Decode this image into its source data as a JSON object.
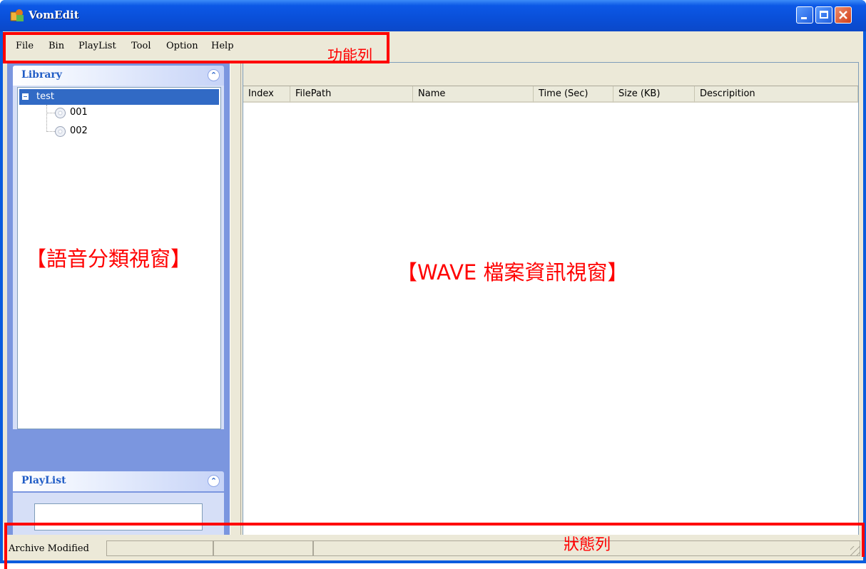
{
  "window": {
    "title": "VomEdit"
  },
  "menu": [
    "File",
    "Bin",
    "PlayList",
    "Tool",
    "Option",
    "Help"
  ],
  "library": {
    "title": "Library",
    "tree": {
      "root": "test",
      "children": [
        "001",
        "002"
      ]
    }
  },
  "playlist": {
    "title": "PlayList",
    "field_value": ""
  },
  "table": {
    "columns": [
      "Index",
      "FilePath",
      "Name",
      "Time (Sec)",
      "Size (KB)",
      "Descripition"
    ]
  },
  "status": {
    "text": "Archive Modified"
  },
  "annotations": {
    "menubar": "功能列",
    "category_window": "【語音分類視窗】",
    "wave_window": "【WAVE 檔案資訊視窗】",
    "statusbar": "狀態列",
    "color": "#ff0000"
  },
  "colors": {
    "titlebar": "#0a5cde",
    "selection": "#316ac5",
    "panel_title": "#215dc6"
  }
}
